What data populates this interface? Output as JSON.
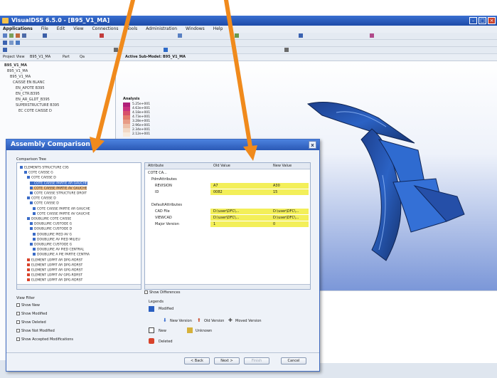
{
  "app": {
    "title": "VisualDSS 6.5.0 - [B95_V1_MA]",
    "menu": [
      "Applications",
      "File",
      "Edit",
      "View",
      "Connections",
      "Tools",
      "Administration",
      "Windows",
      "Help"
    ],
    "model_label": "Active Sub-Model: B95_V1_MA",
    "project_tabs": [
      "Project View",
      "B95_V1_MA",
      "Part",
      "Qa"
    ],
    "tree_root": "B95_V1_MA",
    "tree_items": [
      "B95_V1_MA",
      "B95_V1_MA",
      "B95_V1_MA",
      "CAISSE EN BLANC",
      "EN_APOTE B395",
      "EN_CTR.B395",
      "EN_AR_GLDT_B395",
      "SUPERSTRUCTURE B395",
      "EC COTE CAISSE D"
    ],
    "legend_title": "Analysis",
    "legend_values": [
      "5.25e+001",
      "4.63e+001",
      "4.18e+001",
      "4.73e+001",
      "3.28e+001",
      "2.96e+001",
      "2.34e+001",
      "2.12e+001"
    ],
    "legend_colors": [
      "#b0207a",
      "#c8327e",
      "#d7506a",
      "#e27a6a",
      "#e79b86",
      "#edbfa8",
      "#f2d8c5",
      "#f7eadd"
    ]
  },
  "dialog": {
    "title": "Assembly Comparison",
    "close_label": "x",
    "tree_header": "Comparison Tree",
    "tree": [
      {
        "label": "ELEMENTS STRUCTURE C95",
        "style": ""
      },
      {
        "label": "COTE CAISSE G",
        "style": ""
      },
      {
        "label": "COTE CAISSE D",
        "style": ""
      },
      {
        "label": "COTE CAISSE PARTIE AR GAUCHE",
        "style": "sel"
      },
      {
        "label": "COTE CAISSE PARTIE AV GAUCHE",
        "style": "hl"
      },
      {
        "label": "COTE CAISSE STRUCTURE DROIT",
        "style": ""
      },
      {
        "label": "COTE CAISSE D",
        "style": ""
      },
      {
        "label": "COTE CAISSE D",
        "style": ""
      },
      {
        "label": "COTE CAISSE PARTIE AR GAUCHE",
        "style": ""
      },
      {
        "label": "COTE CAISSE PARTIE AV GAUCHE",
        "style": ""
      },
      {
        "label": "DOUBLURE COTE CAISSE",
        "style": ""
      },
      {
        "label": "DOUBLURE CUSTODE G",
        "style": ""
      },
      {
        "label": "DOUBLURE CUSTODE D",
        "style": ""
      },
      {
        "label": "DOUBLURE PIED AV G",
        "style": ""
      },
      {
        "label": "DOUBLURE AV PIED MILIEU",
        "style": ""
      },
      {
        "label": "DOUBLURE CUSTODE G",
        "style": ""
      },
      {
        "label": "DOUBLURE AV PIED CENTRAL",
        "style": ""
      },
      {
        "label": "DOUBLURE A PIE PARTIE CENTRA",
        "style": ""
      },
      {
        "label": "ELEMENT LOPRT AR DPG-RDRST",
        "style": ""
      },
      {
        "label": "ELEMENT LOPRT AR DPG-RDRST",
        "style": ""
      },
      {
        "label": "ELEMENT LOPRT AR GPG-RDRST",
        "style": ""
      },
      {
        "label": "ELEMENT LOPRT AV GPG-RDRST",
        "style": ""
      },
      {
        "label": "ELEMENT LOPRT AR DPG-RDRST",
        "style": ""
      }
    ],
    "attr_headers": [
      "Attribute",
      "Old Value",
      "New Value"
    ],
    "attr_rows": [
      {
        "attr": "COTE CA...",
        "old": "",
        "new": "",
        "hl": false,
        "indent": 0
      },
      {
        "attr": "PdmAttributes",
        "old": "",
        "new": "",
        "hl": false,
        "indent": 1
      },
      {
        "attr": "REVISION",
        "old": "A7",
        "new": "A30",
        "hl": true,
        "indent": 2
      },
      {
        "attr": "ID",
        "old": "0082",
        "new": "15",
        "hl": true,
        "indent": 2
      },
      {
        "attr": "",
        "old": "",
        "new": "",
        "hl": false,
        "indent": 0
      },
      {
        "attr": "DefaultAttributes",
        "old": "",
        "new": "",
        "hl": false,
        "indent": 1
      },
      {
        "attr": "CAD File",
        "old": "D:\\user\\DFC\\...",
        "new": "D:\\user\\DFC\\...",
        "hl": true,
        "indent": 2
      },
      {
        "attr": "VIEWCAD",
        "old": "D:\\user\\DFC\\...",
        "new": "D:\\user\\DFC\\...",
        "hl": true,
        "indent": 2
      },
      {
        "attr": "Major Version",
        "old": "1",
        "new": "0",
        "hl": true,
        "indent": 2
      }
    ],
    "show_differences": "Show Differences",
    "view_filter": "View Filter",
    "filters": [
      "Show New",
      "Show Modified",
      "Show Deleted",
      "Show Not Modified",
      "Show Accepted Modifications"
    ],
    "legend_title": "Legends",
    "legend": {
      "modified": "Modified",
      "new_version": "New Version",
      "old_version": "Old Version",
      "moved_version": "Moved Version",
      "new": "New",
      "unknown": "Unknown",
      "deleted": "Deleted"
    },
    "colors": {
      "modified": "#2a5fc1",
      "new_version": "#3c6fd1",
      "old_version": "#c94d2e",
      "moved_version": "#4a4a4a",
      "new": "#ffffff",
      "unknown": "#d6b13a",
      "deleted": "#d8432b"
    },
    "buttons": [
      "< Back",
      "Next >",
      "Finish",
      "Cancel"
    ]
  },
  "colors": {
    "arrow": "#f08a1c",
    "accent": "#2a58b5"
  }
}
